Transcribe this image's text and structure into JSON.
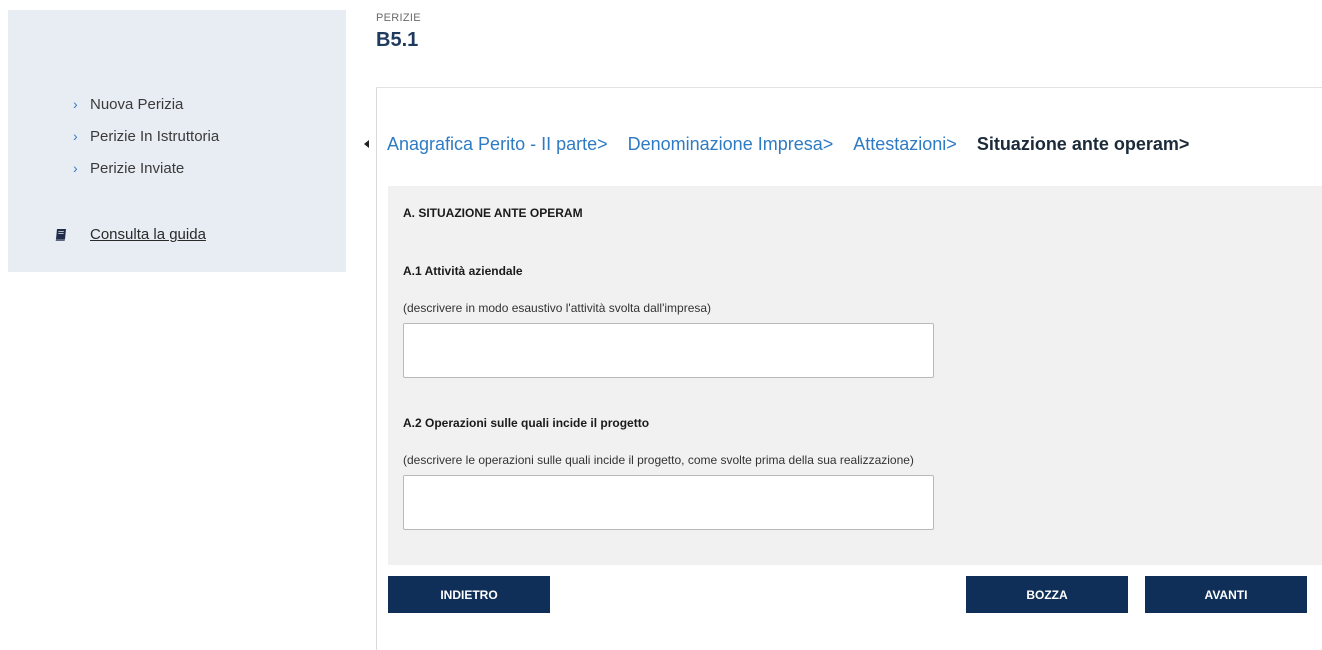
{
  "sidebar": {
    "items": [
      {
        "label": "Nuova Perizia"
      },
      {
        "label": "Perizie In Istruttoria"
      },
      {
        "label": "Perizie Inviate"
      }
    ],
    "guide_label": "Consulta la guida"
  },
  "header": {
    "kicker": "PERIZIE",
    "title": "B5.1"
  },
  "wizard": {
    "steps": [
      {
        "label": "Anagrafica Perito - II parte>"
      },
      {
        "label": "Denominazione Impresa>"
      },
      {
        "label": "Attestazioni>"
      },
      {
        "label": "Situazione ante operam>"
      }
    ],
    "current_index": 3
  },
  "form": {
    "section_title": "A. SITUAZIONE ANTE OPERAM",
    "questions": [
      {
        "label": "A.1 Attività aziendale",
        "hint": "(descrivere in modo esaustivo l'attività svolta dall'impresa)",
        "value": ""
      },
      {
        "label": "A.2 Operazioni sulle quali incide il progetto",
        "hint": "(descrivere le operazioni sulle quali incide il progetto, come svolte prima della sua realizzazione)",
        "value": ""
      }
    ]
  },
  "buttons": {
    "back": "INDIETRO",
    "draft": "BOZZA",
    "next": "AVANTI"
  },
  "colors": {
    "sidebar_bg": "#e8edf4",
    "link_blue": "#2e7bc4",
    "title_navy": "#1f3a5f",
    "button_navy": "#0f2f58",
    "panel_bg": "#f1f1f1"
  }
}
